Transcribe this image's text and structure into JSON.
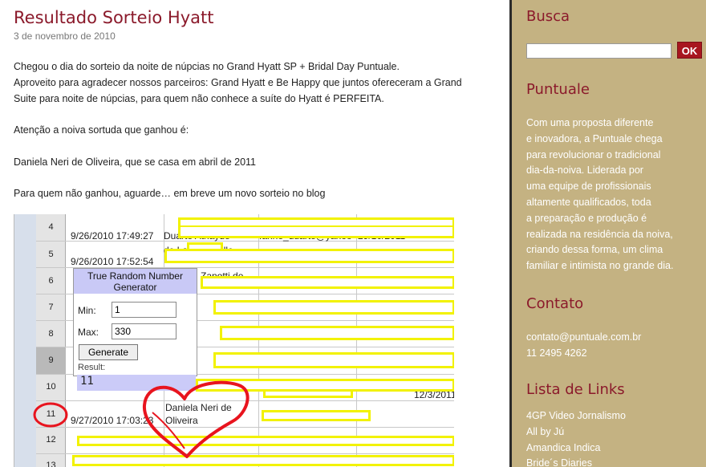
{
  "post": {
    "title": "Resultado Sorteio Hyatt",
    "date": "3 de novembro de 2010",
    "paragraphs": [
      "Chegou o dia do sorteio da noite de núpcias no Grand Hyatt SP + Bridal Day Puntuale.",
      "Aproveito para agradecer nossos parceiros: Grand Hyatt e Be Happy que juntos ofereceram a Grand",
      "Suite para noite de núpcias, para quem não conhece a suíte do Hyatt é PERFEITA.",
      "Atenção a noiva sortuda que ganhou é:",
      "Daniela Neri de Oliveira, que se casa em abril de 2011",
      "Para quem não ganhou, aguarde… em breve um novo sorteio no blog"
    ]
  },
  "screenshot": {
    "row_numbers": [
      "4",
      "5",
      "6",
      "7",
      "8",
      "9",
      "10",
      "11",
      "12",
      "13"
    ],
    "cells": {
      "r4_date": "9/26/2010 17:49:27",
      "r4_name": "Duarte Athayde",
      "r4_email": "fanne_duarte@yahoo",
      "r4_date2": "29/10/2011",
      "r5_date": "9/26/2010 17:52:54",
      "r5_name": "de Lana Camillo",
      "r6_name": "Zanotti de",
      "r11_date": "9/27/2010 17:03:23",
      "r11_name_line1": "Daniela Neri de",
      "r11_name_line2": "Oliveira",
      "r10_date2": "12/3/2011"
    },
    "rng": {
      "title": "True Random Number Generator",
      "min_label": "Min:",
      "min_value": "1",
      "max_label": "Max:",
      "max_value": "330",
      "generate_label": "Generate",
      "result_label": "Result:",
      "result_value": "11"
    },
    "highlight_color": "#f2f200",
    "heart_color": "#e8141e"
  },
  "sidebar": {
    "search_heading": "Busca",
    "search_value": "",
    "ok_label": "OK",
    "puntuale_heading": "Puntuale",
    "puntuale_lines": [
      "Com uma proposta diferente",
      "e inovadora, a Puntuale chega",
      "para revolucionar o tradicional",
      "dia-da-noiva. Liderada por",
      "uma equipe de profissionais",
      "altamente qualificados, toda",
      "a preparação e produção é",
      "realizada na residência da noiva,",
      "criando dessa forma, um clima",
      "familiar e intimista no grande dia."
    ],
    "contato_heading": "Contato",
    "contato_email": "contato@puntuale.com.br",
    "contato_phone": "11 2495 4262",
    "links_heading": "Lista de Links",
    "links": [
      "4GP Video Jornalismo",
      "All by Jú",
      "Amandica Indica",
      "Bride´s Diaries"
    ],
    "bg_color": "#c4b282",
    "heading_color": "#8b1a2b"
  }
}
